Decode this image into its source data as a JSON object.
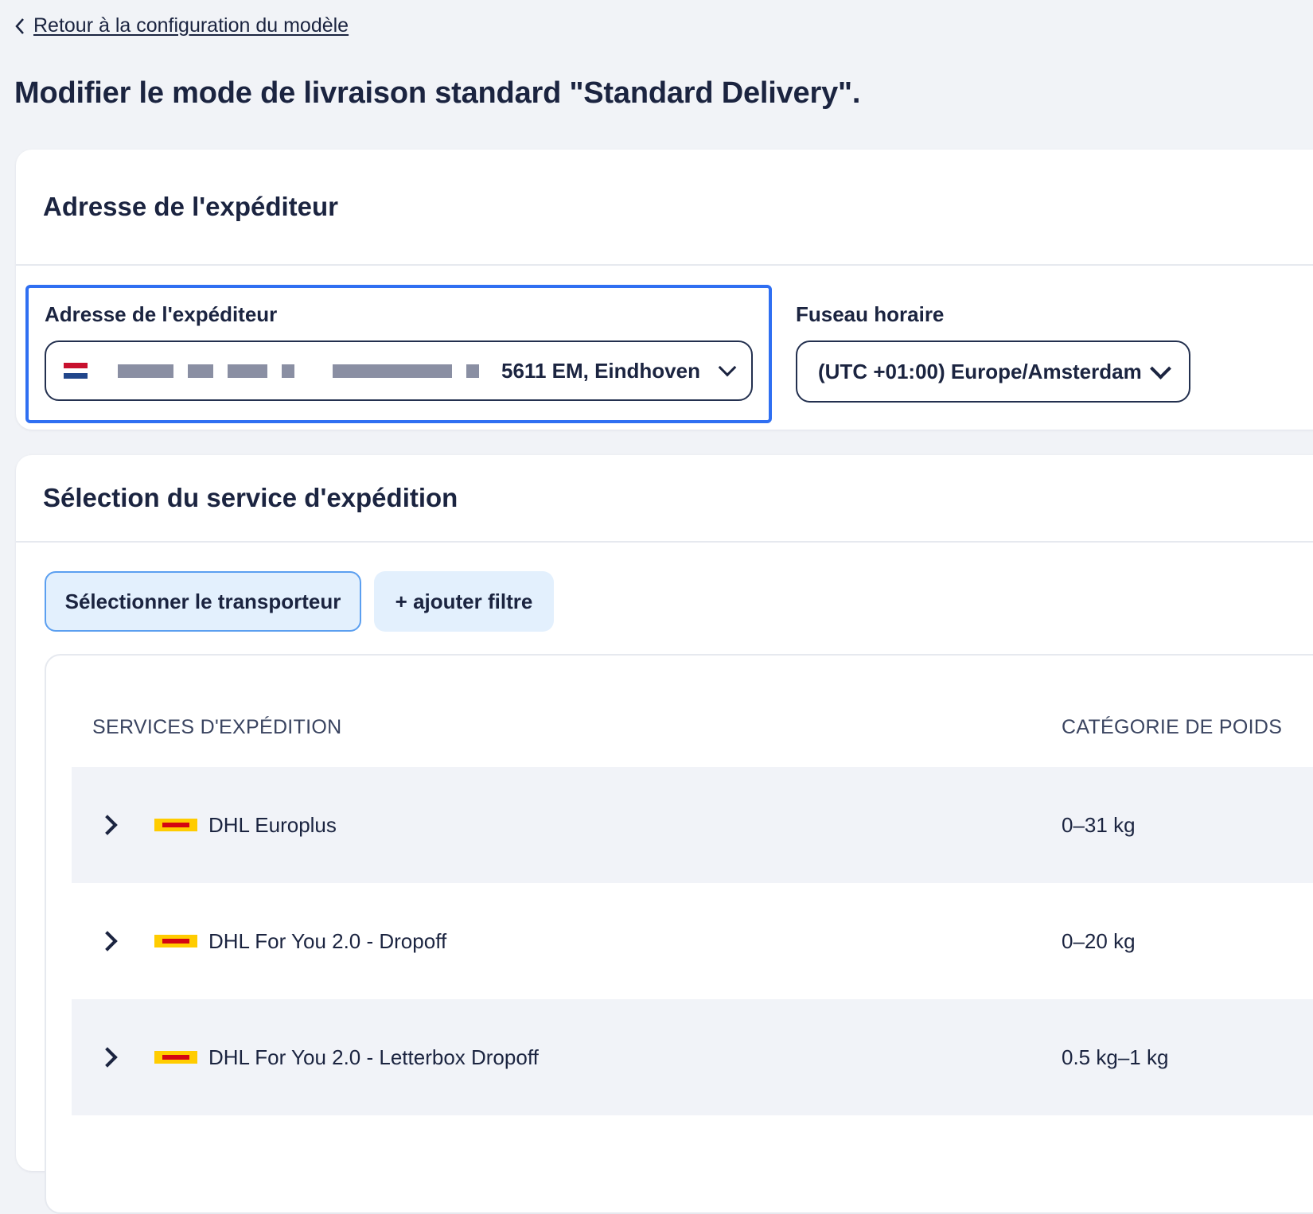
{
  "back_link": {
    "label": "Retour à la configuration du modèle"
  },
  "page_title": "Modifier le mode de livraison standard \"Standard Delivery\".",
  "sender_card": {
    "heading": "Adresse de l'expéditeur",
    "address_field": {
      "label": "Adresse de l'expéditeur",
      "country_flag": "netherlands-flag",
      "value_visible": "5611 EM, Eindhoven"
    },
    "timezone_field": {
      "label": "Fuseau horaire",
      "value": "(UTC +01:00) Europe/Amsterdam"
    }
  },
  "service_card": {
    "heading": "Sélection du service d'expédition",
    "buttons": {
      "select_carrier": "Sélectionner le transporteur",
      "add_filter": "+ ajouter filtre"
    },
    "table": {
      "columns": [
        "SERVICES D'EXPÉDITION",
        "CATÉGORIE DE POIDS"
      ],
      "rows": [
        {
          "carrier_icon": "dhl-logo",
          "service": "DHL Europlus",
          "weight": "0–31 kg"
        },
        {
          "carrier_icon": "dhl-logo",
          "service": "DHL For You 2.0 - Dropoff",
          "weight": "0–20 kg"
        },
        {
          "carrier_icon": "dhl-logo",
          "service": "DHL For You 2.0 - Letterbox Dropoff",
          "weight": "0.5 kg–1 kg"
        }
      ]
    }
  },
  "colors": {
    "background": "#f1f3f7",
    "text": "#1b2440",
    "focus_border": "#2f6ff2",
    "button_bg": "#e3f0fd",
    "row_shade": "#f1f3f8",
    "dhl_yellow": "#ffcc00",
    "dhl_red": "#d40511"
  }
}
